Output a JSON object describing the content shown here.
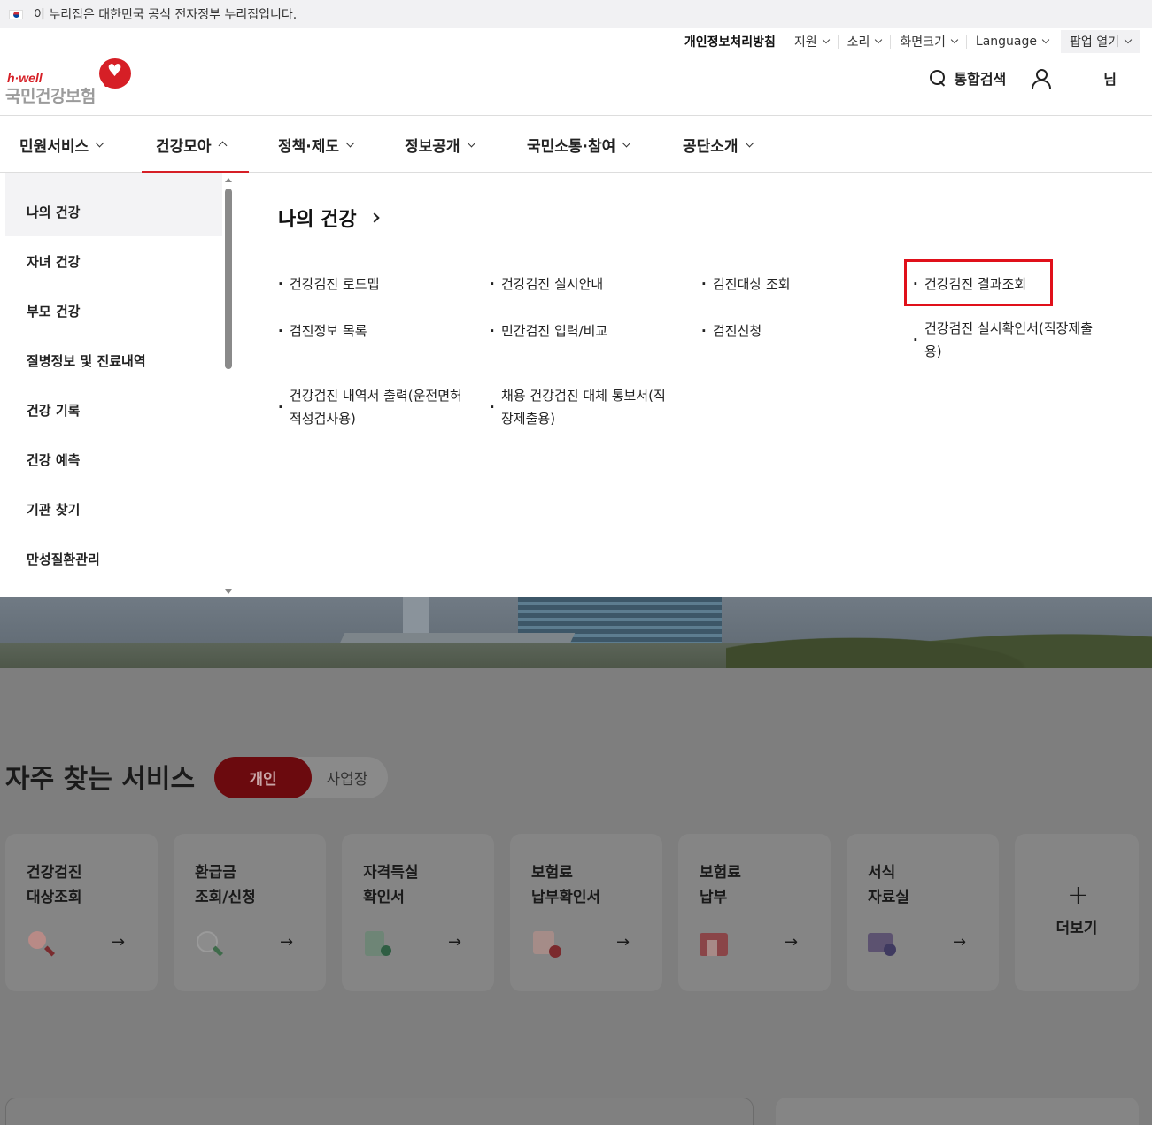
{
  "gov_banner": {
    "text": "이 누리집은 대한민국 공식 전자정부 누리집입니다."
  },
  "utility": {
    "privacy": "개인정보처리방침",
    "support": "지원",
    "sound": "소리",
    "screen_size": "화면크기",
    "language": "Language",
    "popup": "팝업 열기"
  },
  "logo": {
    "brand": "h·well",
    "name": "국민건강보험"
  },
  "header": {
    "search": "통합검색",
    "user_suffix": "님"
  },
  "gnb": [
    {
      "label": "민원서비스",
      "active": false
    },
    {
      "label": "건강모아",
      "active": true
    },
    {
      "label": "정책·제도",
      "active": false
    },
    {
      "label": "정보공개",
      "active": false
    },
    {
      "label": "국민소통·참여",
      "active": false
    },
    {
      "label": "공단소개",
      "active": false
    }
  ],
  "side_menu": [
    {
      "label": "나의 건강",
      "selected": true
    },
    {
      "label": "자녀 건강",
      "selected": false
    },
    {
      "label": "부모 건강",
      "selected": false
    },
    {
      "label": "질병정보 및 진료내역",
      "selected": false
    },
    {
      "label": "건강 기록",
      "selected": false
    },
    {
      "label": "건강 예측",
      "selected": false
    },
    {
      "label": "기관 찾기",
      "selected": false
    },
    {
      "label": "만성질환관리",
      "selected": false
    }
  ],
  "mega": {
    "title": "나의 건강",
    "items": [
      "건강검진 로드맵",
      "건강검진 실시안내",
      "검진대상 조회",
      "건강검진 결과조회",
      "검진정보 목록",
      "민간검진 입력/비교",
      "검진신청",
      "건강검진 실시확인서(직장제출용)",
      "건강검진 내역서 출력(운전면허적성검사용)",
      "채용 건강검진 대체 통보서(직장제출용)"
    ]
  },
  "frequent": {
    "title": "자주 찾는 서비스",
    "tab_personal": "개인",
    "tab_business": "사업장",
    "cards": [
      {
        "label": "건강검진\n대상조회",
        "icon": "search-person-icon"
      },
      {
        "label": "환급금\n조회/신청",
        "icon": "search-money-icon"
      },
      {
        "label": "자격득실\n확인서",
        "icon": "document-person-icon"
      },
      {
        "label": "보험료\n납부확인서",
        "icon": "document-heart-icon"
      },
      {
        "label": "보험료\n납부",
        "icon": "card-payment-icon"
      },
      {
        "label": "서식\n자료실",
        "icon": "folder-download-icon"
      }
    ],
    "arrow": "→",
    "more_plus": "+",
    "more": "더보기"
  }
}
